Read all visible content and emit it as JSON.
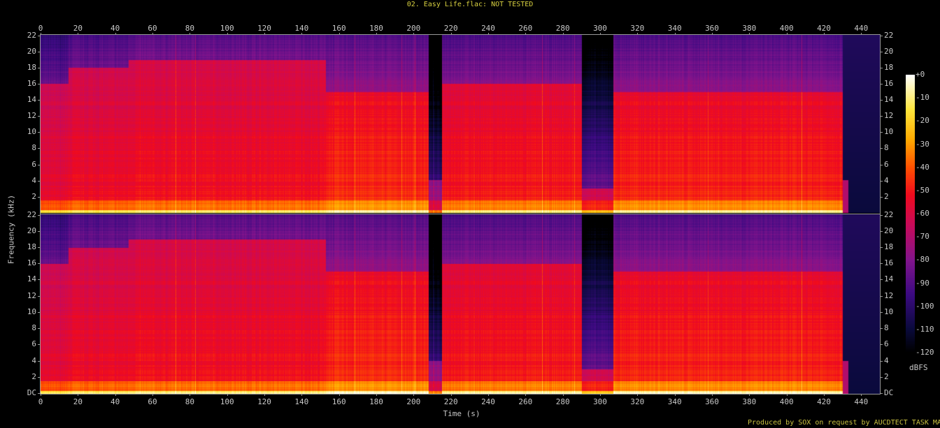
{
  "title": "02. Easy Life.flac: NOT TESTED",
  "footer": "Produced by SOX on request by AUCDTECT TASK MANAGER",
  "chart_data": {
    "type": "heatmap",
    "title": "02. Easy Life.flac: NOT TESTED",
    "xlabel": "Time (s)",
    "ylabel": "Frequency (kHz)",
    "xlim": [
      0,
      450
    ],
    "ylim": [
      0,
      22.05
    ],
    "x_ticks": [
      "0",
      "20",
      "40",
      "60",
      "80",
      "100",
      "120",
      "140",
      "160",
      "180",
      "200",
      "220",
      "240",
      "260",
      "280",
      "300",
      "320",
      "340",
      "360",
      "380",
      "400",
      "420",
      "440"
    ],
    "y_ticks": [
      "DC",
      "2",
      "4",
      "6",
      "8",
      "10",
      "12",
      "14",
      "16",
      "18",
      "20",
      "22"
    ],
    "channels": 2,
    "colorbar": {
      "label": "dBFS",
      "ticks": [
        "+0",
        "-10",
        "-20",
        "-30",
        "-40",
        "-50",
        "-60",
        "-70",
        "-80",
        "-90",
        "-100",
        "-110",
        "-120"
      ],
      "range": [
        -120,
        0
      ]
    },
    "segments": [
      {
        "t": [
          0,
          15
        ],
        "level_db": -55,
        "cutoff_khz": 16
      },
      {
        "t": [
          15,
          47
        ],
        "level_db": -52,
        "cutoff_khz": 18
      },
      {
        "t": [
          47,
          153
        ],
        "level_db": -50,
        "cutoff_khz": 19
      },
      {
        "t": [
          153,
          208
        ],
        "level_db": -45,
        "cutoff_khz": 15
      },
      {
        "t": [
          208,
          215
        ],
        "level_db": -75,
        "cutoff_khz": 4
      },
      {
        "t": [
          215,
          290
        ],
        "level_db": -48,
        "cutoff_khz": 16
      },
      {
        "t": [
          290,
          307
        ],
        "level_db": -62,
        "cutoff_khz": 3
      },
      {
        "t": [
          307,
          430
        ],
        "level_db": -46,
        "cutoff_khz": 15
      },
      {
        "t": [
          430,
          450
        ],
        "level_db": -110,
        "cutoff_khz": 0
      }
    ]
  }
}
